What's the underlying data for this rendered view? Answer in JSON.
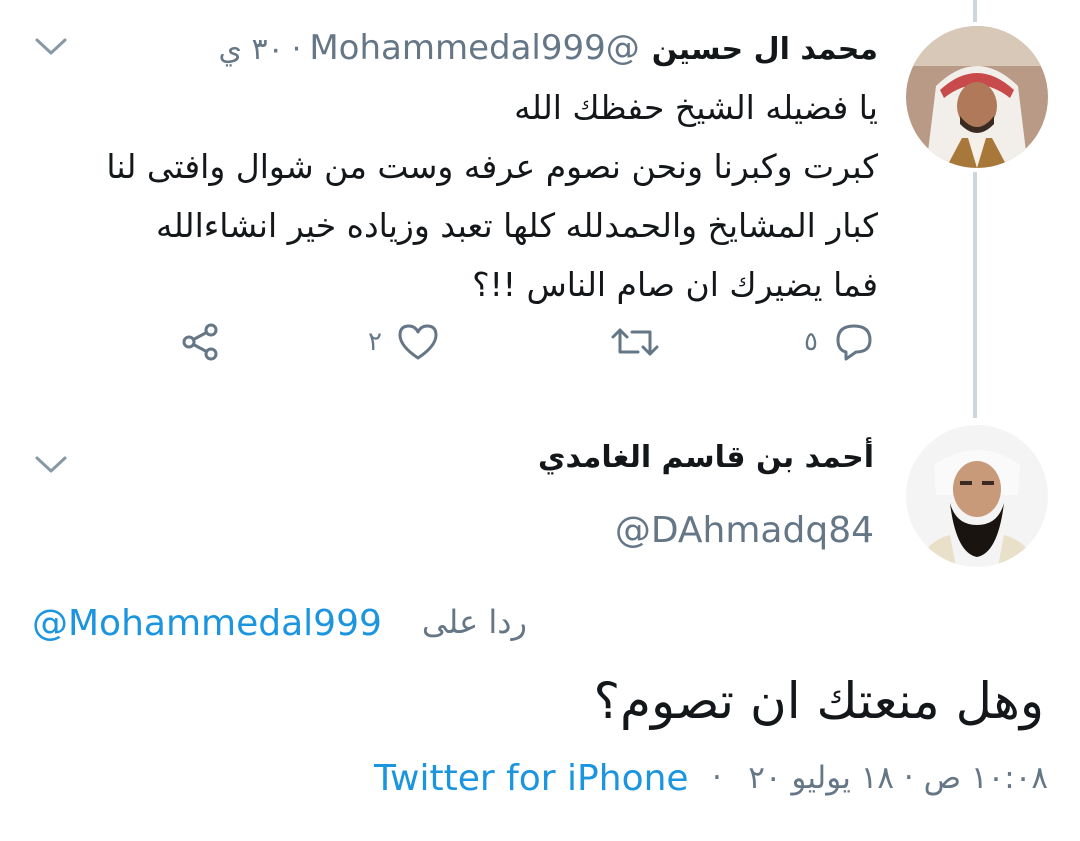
{
  "colors": {
    "text": "#14171a",
    "secondary": "#657786",
    "link": "#1b95e0",
    "thread_line": "#ccd6dd"
  },
  "parent_tweet": {
    "author_name": "محمد ال حسين",
    "handle": "@Mohammedal999",
    "separator": "·",
    "time": "٣٠ ي",
    "lines": [
      "يا فضيله الشيخ حفظك الله",
      "كبرت وكبرنا ونحن نصوم عرفه وست من شوال وافتى لنا",
      "كبار المشايخ  والحمدلله كلها تعبد وزياده خير انشاءالله",
      "فما يضيرك ان صام الناس !!؟"
    ],
    "actions": {
      "reply_count": "٥",
      "retweet_count": "",
      "like_count": "٢"
    },
    "icons": [
      "reply-icon",
      "retweet-icon",
      "like-icon",
      "share-icon",
      "chevron-down-icon"
    ]
  },
  "focused_tweet": {
    "author_name": "أحمد بن قاسم الغامدي",
    "handle": "@DAhmadq84",
    "replying_label": "ردا على",
    "replying_to": "@Mohammedal999",
    "text": "وهل منعتك ان تصوم؟",
    "timestamp": "١٠:٠٨ ص · ١٨ يوليو ٢٠",
    "meta_separator": "·",
    "source": "Twitter for iPhone"
  }
}
